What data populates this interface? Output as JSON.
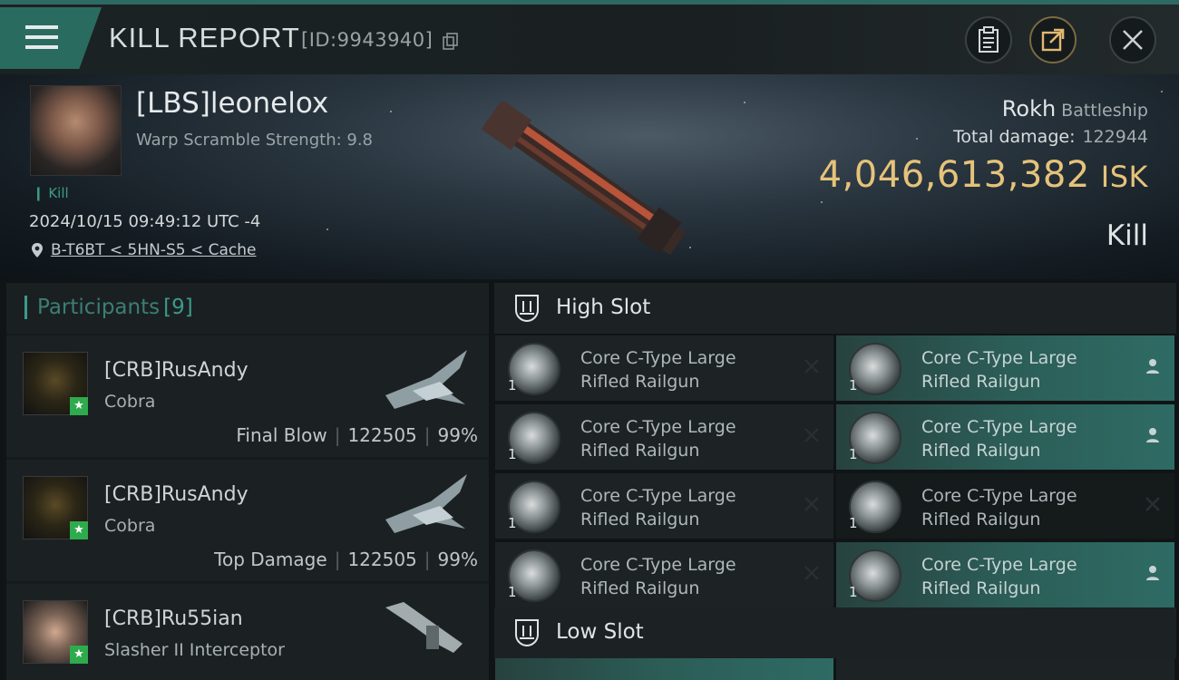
{
  "header": {
    "title": "KILL REPORT",
    "report_id": "[ID:9943940]",
    "buttons": [
      "clipboard-icon",
      "share-icon",
      "close-icon"
    ]
  },
  "victim": {
    "name": "[LBS]leonelox",
    "warp_scramble": "Warp Scramble Strength: 9.8",
    "tag": "Kill",
    "datetime": "2024/10/15 09:49:12 UTC -4",
    "location": "B-T6BT < 5HN-S5 < Cache",
    "ship": "Rokh",
    "ship_class": "Battleship",
    "total_damage_label": "Total damage:",
    "total_damage": "122944",
    "isk_value": "4,046,613,382",
    "isk_unit": "ISK",
    "result": "Kill"
  },
  "participants": {
    "label": "Participants",
    "count": "[9]",
    "items": [
      {
        "name": "[CRB]RusAndy",
        "ship": "Cobra",
        "role": "Final Blow",
        "damage": "122505",
        "percent": "99%"
      },
      {
        "name": "[CRB]RusAndy",
        "ship": "Cobra",
        "role": "Top Damage",
        "damage": "122505",
        "percent": "99%"
      },
      {
        "name": "[CRB]Ru55ian",
        "ship": "Slasher II Interceptor",
        "role": "",
        "damage": "",
        "percent": ""
      }
    ]
  },
  "high_slot": {
    "label": "High Slot",
    "modules": [
      {
        "name_l1": "Core C-Type Large",
        "name_l2": "Rifled Railgun",
        "qty": "1",
        "state": "destroyed",
        "style": "dark"
      },
      {
        "name_l1": "Core C-Type Large",
        "name_l2": "Rifled Railgun",
        "qty": "1",
        "state": "dropped",
        "style": "teal"
      },
      {
        "name_l1": "Core C-Type Large",
        "name_l2": "Rifled Railgun",
        "qty": "1",
        "state": "destroyed",
        "style": "dark"
      },
      {
        "name_l1": "Core C-Type Large",
        "name_l2": "Rifled Railgun",
        "qty": "1",
        "state": "dropped",
        "style": "teal"
      },
      {
        "name_l1": "Core C-Type Large",
        "name_l2": "Rifled Railgun",
        "qty": "1",
        "state": "destroyed",
        "style": "dark"
      },
      {
        "name_l1": "Core C-Type Large",
        "name_l2": "Rifled Railgun",
        "qty": "1",
        "state": "destroyed",
        "style": "black"
      },
      {
        "name_l1": "Core C-Type Large",
        "name_l2": "Rifled Railgun",
        "qty": "1",
        "state": "destroyed",
        "style": "dark"
      },
      {
        "name_l1": "Core C-Type Large",
        "name_l2": "Rifled Railgun",
        "qty": "1",
        "state": "dropped",
        "style": "teal"
      }
    ]
  },
  "low_slot": {
    "label": "Low Slot"
  },
  "colors": {
    "accent": "#3c9a8c",
    "isk": "#e6c37a",
    "dropped_bg": "#2c5d57",
    "destroyed_bg": "#1d2325"
  }
}
